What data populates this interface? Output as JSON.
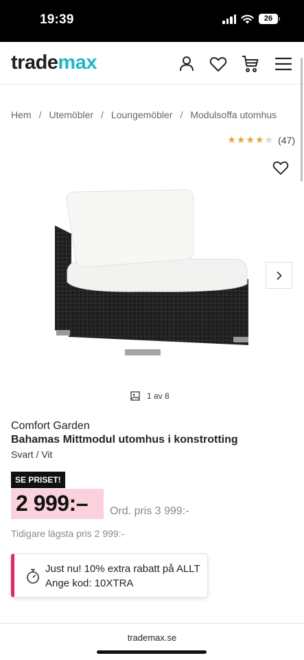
{
  "status_bar": {
    "time": "19:39",
    "battery": "26"
  },
  "header": {
    "logo_part1": "trade",
    "logo_part2": "max"
  },
  "breadcrumb": [
    "Hem",
    "Utemöbler",
    "Loungemöbler",
    "Modulsoffa utomhus"
  ],
  "rating": {
    "value": 4.5,
    "max": 5,
    "count": "(47)"
  },
  "gallery": {
    "counter": "1 av 8"
  },
  "product": {
    "brand": "Comfort Garden",
    "title": "Bahamas Mittmodul utomhus i konstrotting",
    "variant": "Svart / Vit",
    "badge": "SE PRISET!",
    "price": "2 999:–",
    "ord_price": "Ord. pris 3 999:-",
    "lowest_price": "Tidigare lägsta pris 2 999:-"
  },
  "promo": {
    "line1": "Just nu! 10% extra rabatt på ALLT",
    "line2": "Ange kod: 10XTRA"
  },
  "browser": {
    "url": "trademax.se"
  },
  "colors": {
    "brand_teal": "#1fb6c9",
    "price_bg": "#fbd1dc",
    "promo_accent": "#e3276b",
    "star": "#e8a33d"
  },
  "icons": {
    "header": [
      "user-icon",
      "heart-icon",
      "cart-icon",
      "menu-icon"
    ],
    "gallery": [
      "heart-icon",
      "chevron-right-icon",
      "image-icon"
    ],
    "promo": "stopwatch-icon"
  }
}
